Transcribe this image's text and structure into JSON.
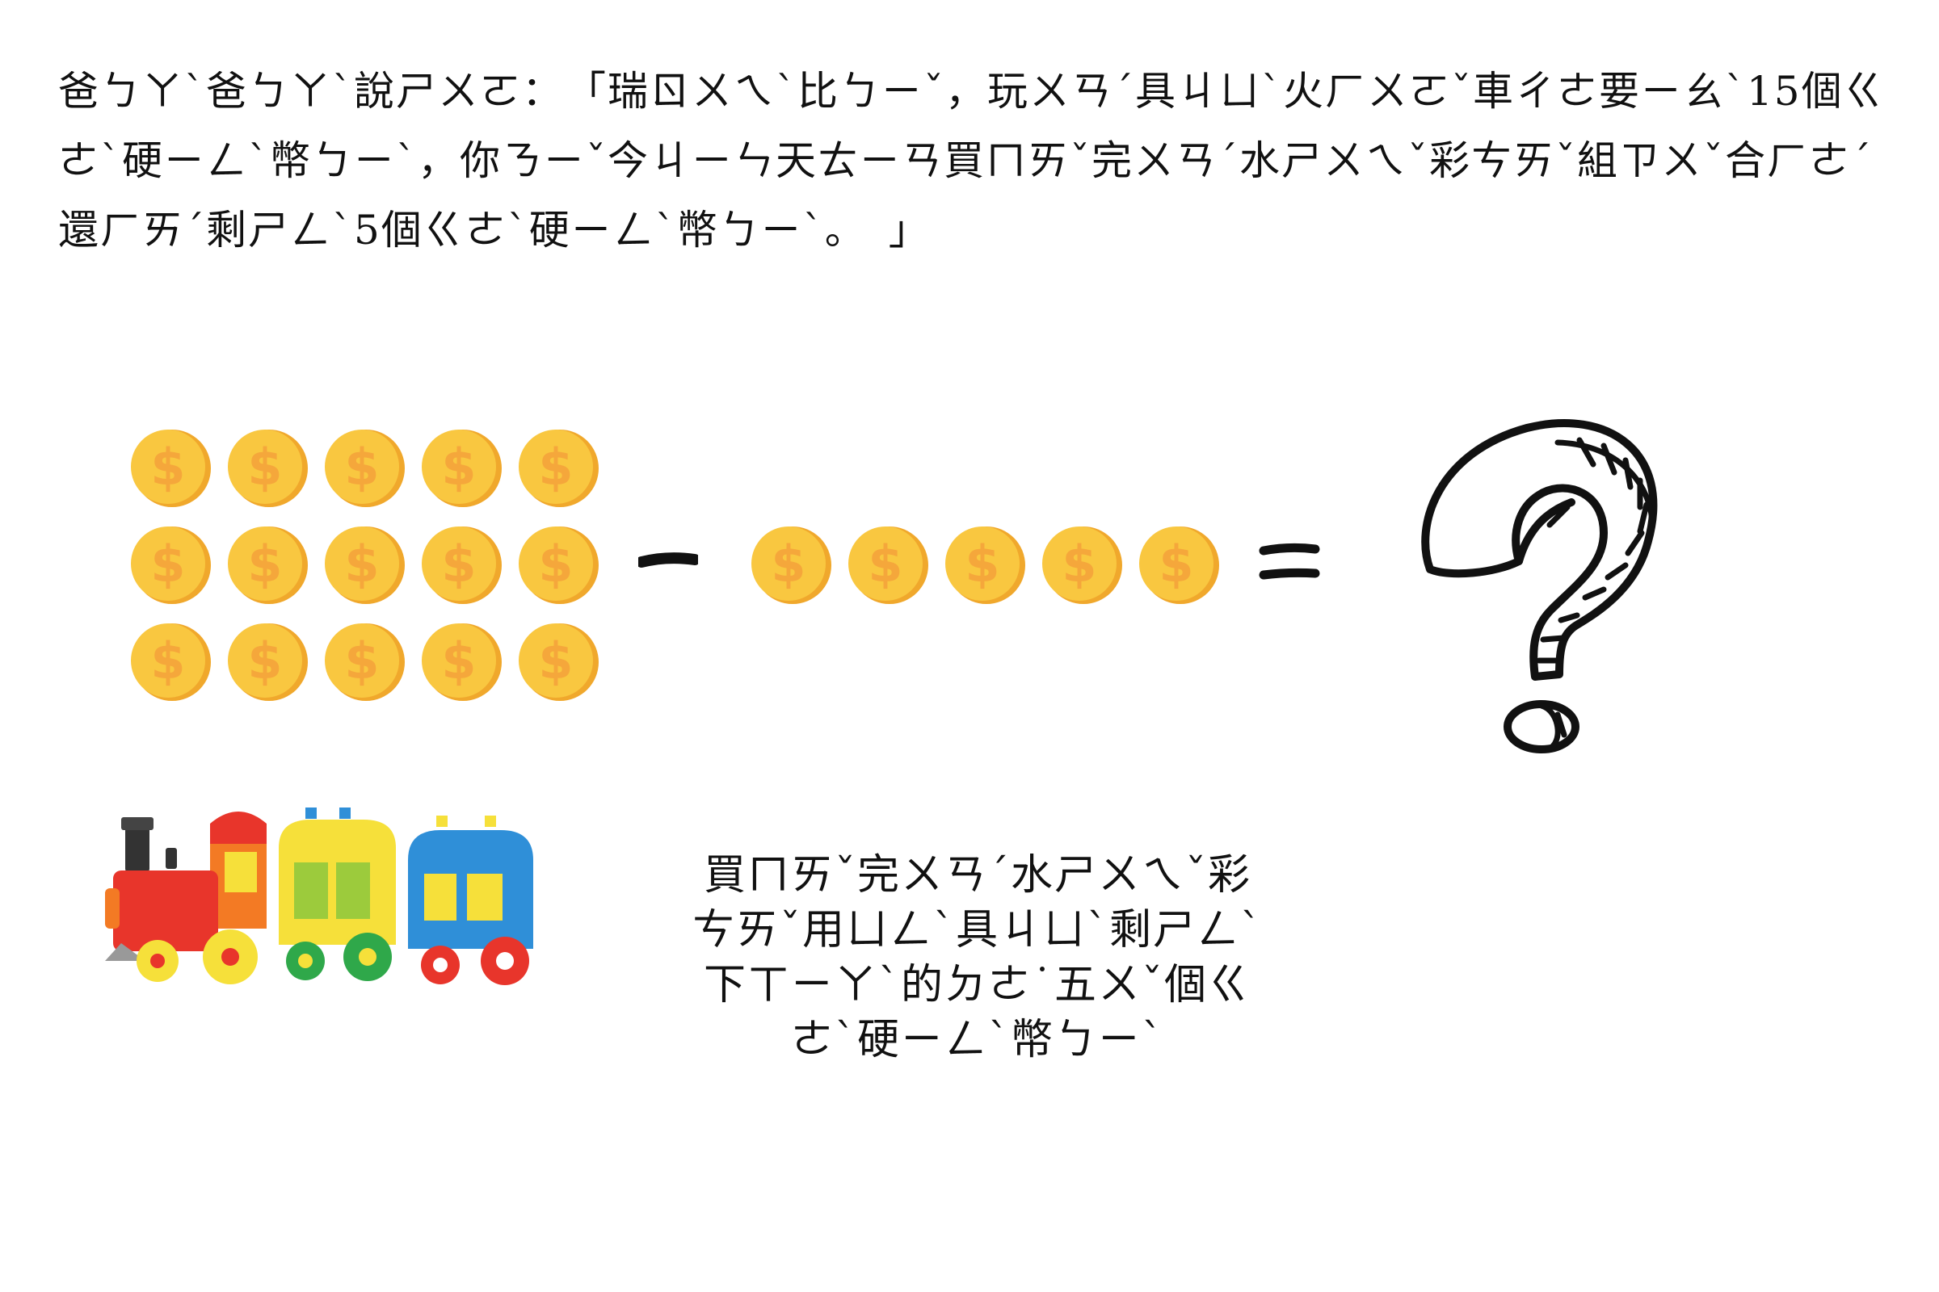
{
  "story": {
    "text": "爸ㄅㄚˋ爸ㄅㄚˋ說ㄕㄨㄛ：　「瑞ㄖㄨㄟˋ比ㄅㄧˇ，玩ㄨㄢˊ具ㄐㄩˋ火ㄏㄨㄛˇ車ㄔㄜ要ㄧㄠˋ15個ㄍㄜˋ硬ㄧㄥˋ幣ㄅㄧˋ，你ㄋㄧˇ今ㄐㄧㄣ天ㄊㄧㄢ買ㄇㄞˇ完ㄨㄢˊ水ㄕㄨㄟˇ彩ㄘㄞˇ組ㄗㄨˇ合ㄏㄜˊ還ㄏㄞˊ剩ㄕㄥˋ5個ㄍㄜˋ硬ㄧㄥˋ幣ㄅㄧˋ。　」"
  },
  "equation": {
    "total_coins": 15,
    "spent_coins": 5,
    "coin_symbol": "$",
    "operator_minus": "−",
    "operator_equals": "="
  },
  "caption": {
    "line1": "買ㄇㄞˇ完ㄨㄢˊ水ㄕㄨㄟˇ彩ㄘㄞˇ用ㄩㄥˋ具ㄐㄩˋ剩ㄕㄥˋ",
    "line2": "下ㄒㄧㄚˋ的ㄉㄜ˙五ㄨˇ個ㄍㄜˋ硬ㄧㄥˋ幣ㄅㄧˋ"
  },
  "colors": {
    "coin_face": "#F9C740",
    "coin_rim": "#F0A82C",
    "coin_symbol": "#F5A73B",
    "ink": "#111111",
    "train_red": "#E8352B",
    "train_yellow": "#F6E03A",
    "train_blue": "#2F8FD8",
    "train_green": "#2FA84A"
  },
  "icons": {
    "coin": "gold-coin-icon",
    "question": "question-mark-icon",
    "train": "toy-train-icon"
  }
}
